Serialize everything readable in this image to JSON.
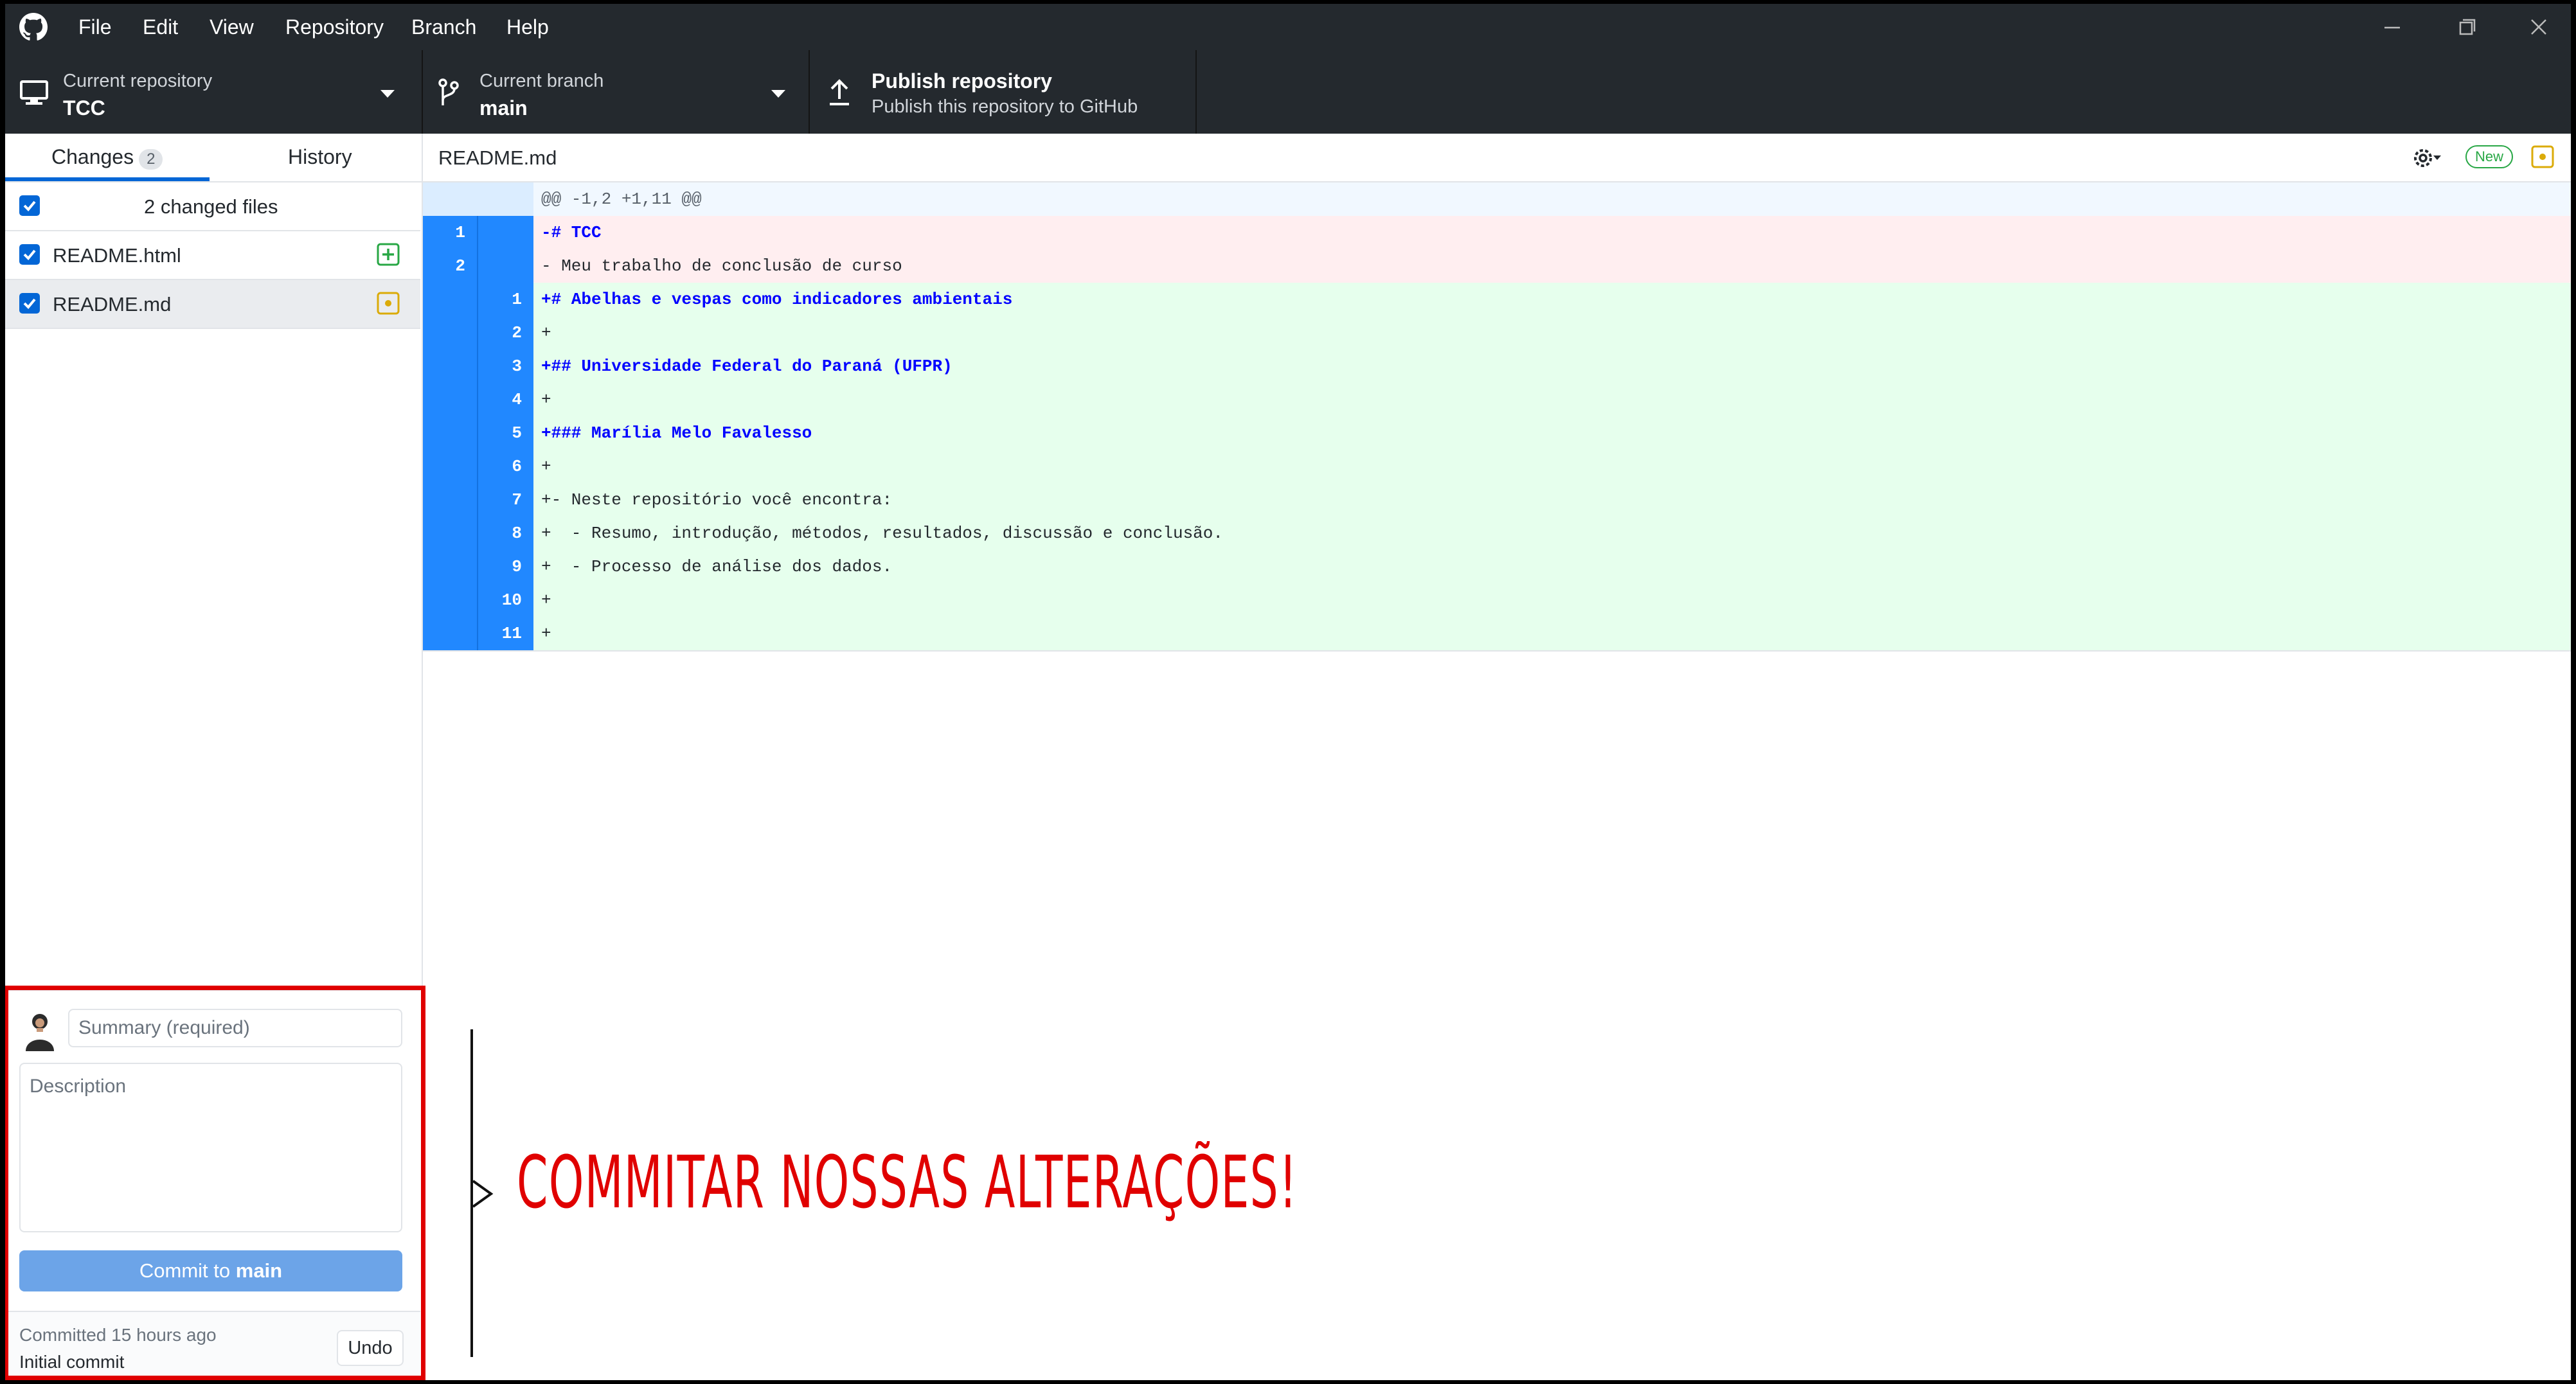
{
  "menu": [
    "File",
    "Edit",
    "View",
    "Repository",
    "Branch",
    "Help"
  ],
  "toolbar": {
    "repo_caption": "Current repository",
    "repo_name": "TCC",
    "branch_caption": "Current branch",
    "branch_name": "main",
    "publish_title": "Publish repository",
    "publish_subtitle": "Publish this repository to GitHub"
  },
  "sidebar": {
    "tabs": [
      {
        "label": "Changes",
        "badge": "2",
        "active": true
      },
      {
        "label": "History",
        "active": false
      }
    ],
    "changed_files_label": "2 changed files",
    "files": [
      {
        "name": "README.html",
        "status": "added",
        "checked": true
      },
      {
        "name": "README.md",
        "status": "modified",
        "checked": true,
        "selected": true
      }
    ]
  },
  "commit": {
    "summary_placeholder": "Summary (required)",
    "description_placeholder": "Description",
    "button_prefix": "Commit to ",
    "button_branch": "main",
    "last_commit_time": "Committed 15 hours ago",
    "last_commit_message": "Initial commit",
    "undo_label": "Undo"
  },
  "diff": {
    "file_name": "README.md",
    "new_badge": "New",
    "lines": [
      {
        "type": "hunk",
        "old": "",
        "new": "",
        "text": "@@ -1,2 +1,11 @@"
      },
      {
        "type": "del",
        "old": "1",
        "new": "",
        "text": "-# TCC",
        "strong": true
      },
      {
        "type": "del",
        "old": "2",
        "new": "",
        "text": "- Meu trabalho de conclusão de curso"
      },
      {
        "type": "add",
        "old": "",
        "new": "1",
        "text": "+# Abelhas e vespas como indicadores ambientais",
        "strong": true
      },
      {
        "type": "add",
        "old": "",
        "new": "2",
        "text": "+"
      },
      {
        "type": "add",
        "old": "",
        "new": "3",
        "text": "+## Universidade Federal do Paraná (UFPR)",
        "strong": true
      },
      {
        "type": "add",
        "old": "",
        "new": "4",
        "text": "+"
      },
      {
        "type": "add",
        "old": "",
        "new": "5",
        "text": "+### Marília Melo Favalesso",
        "strong": true
      },
      {
        "type": "add",
        "old": "",
        "new": "6",
        "text": "+"
      },
      {
        "type": "add",
        "old": "",
        "new": "7",
        "text": "+- Neste repositório você encontra:"
      },
      {
        "type": "add",
        "old": "",
        "new": "8",
        "text": "+  - Resumo, introdução, métodos, resultados, discussão e conclusão."
      },
      {
        "type": "add",
        "old": "",
        "new": "9",
        "text": "+  - Processo de análise dos dados."
      },
      {
        "type": "add",
        "old": "",
        "new": "10",
        "text": "+"
      },
      {
        "type": "add",
        "old": "",
        "new": "11",
        "text": "+"
      }
    ]
  },
  "annotation": {
    "text": "COMMITAR NOSSAS ALTERAÇÕES!",
    "color": "#e00000"
  },
  "colors": {
    "toolbar_bg": "#24292e",
    "accent": "#0366d6",
    "added_bg": "#e6ffed",
    "deleted_bg": "#ffeef0"
  }
}
